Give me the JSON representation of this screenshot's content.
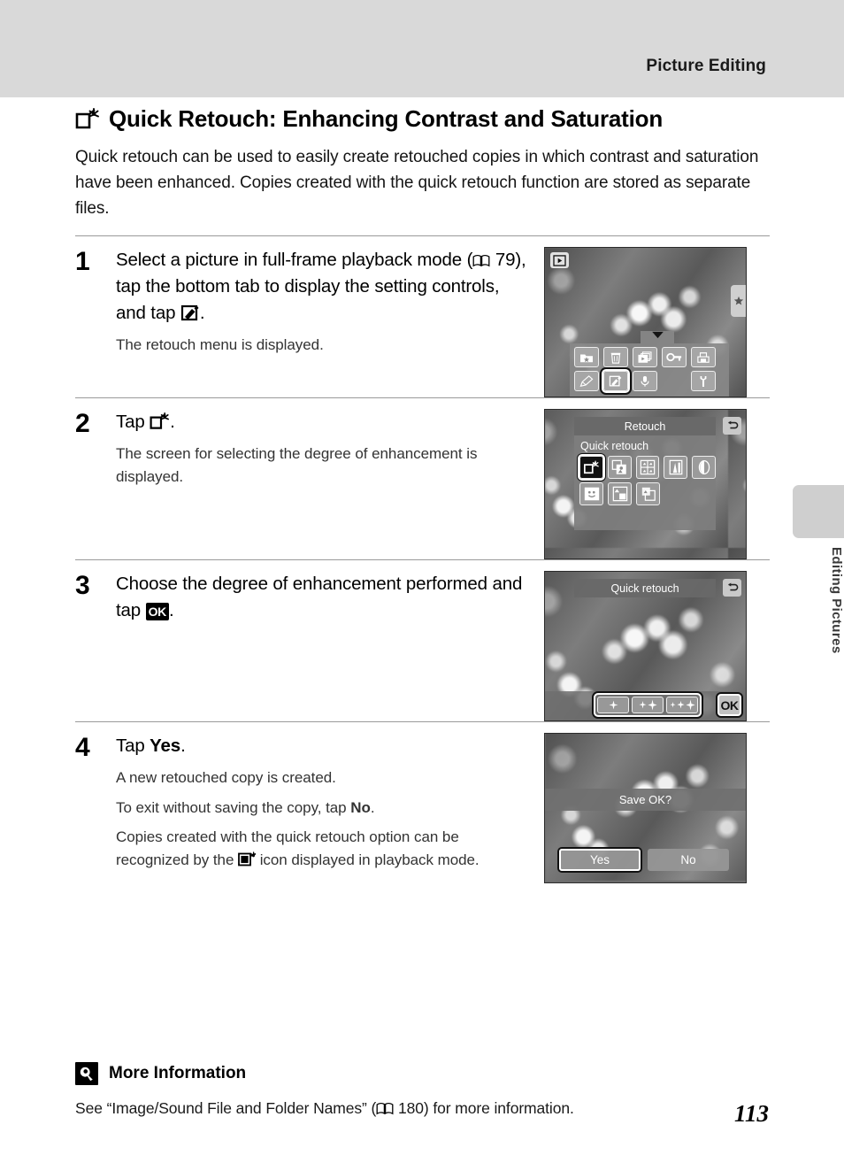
{
  "header": {
    "title": "Picture Editing"
  },
  "side_tab": {
    "label": "Editing Pictures"
  },
  "section": {
    "icon": "quick-retouch-icon",
    "heading": "Quick Retouch: Enhancing Contrast and Saturation",
    "intro": "Quick retouch can be used to easily create retouched copies in which contrast and saturation have been enhanced. Copies created with the quick retouch function are stored as separate files."
  },
  "steps": [
    {
      "number": "1",
      "title_before": "Select a picture in full-frame playback mode (",
      "ref_page": "79",
      "title_middle": "), tap the bottom tab to display the setting controls, and tap ",
      "title_icon": "retouch-pen-icon",
      "title_after": ".",
      "detail": "The retouch menu is displayed."
    },
    {
      "number": "2",
      "title_before": "Tap ",
      "title_icon": "quick-retouch-icon",
      "title_after": ".",
      "detail": "The screen for selecting the degree of enhancement is displayed."
    },
    {
      "number": "3",
      "title_before": "Choose the degree of enhancement performed and tap ",
      "title_icon": "ok-icon",
      "ok_label": "OK",
      "title_after": ".",
      "detail": ""
    },
    {
      "number": "4",
      "title_before": "Tap ",
      "title_bold": "Yes",
      "title_after": ".",
      "detail_1": "A new retouched copy is created.",
      "detail_2_before": "To exit without saving the copy, tap ",
      "detail_2_bold": "No",
      "detail_2_after": ".",
      "detail_3_before": "Copies created with the quick retouch option can be recognized by the ",
      "detail_3_icon": "retouched-copy-badge-icon",
      "detail_3_after": " icon displayed in playback mode."
    }
  ],
  "screens": {
    "shot1": {
      "playback_badge": "playback-icon",
      "favorites_tab": "star-icon",
      "toolbar_icons_row1": [
        "favorites-folder-icon",
        "delete-trash-icon",
        "slideshow-icon",
        "protect-key-icon",
        "print-order-icon"
      ],
      "toolbar_icons_row2": [
        "paint-pencil-icon",
        "retouch-pen-icon",
        "voice-memo-icon",
        "spacer",
        "setup-wrench-icon"
      ],
      "selected_icon": "retouch-pen-icon"
    },
    "shot2": {
      "menu_title": "Retouch",
      "menu_selected_label": "Quick retouch",
      "back_button": "back-arrow-icon",
      "menu_icons_row1": [
        "quick-retouch-icon",
        "d-lighting-icon",
        "soft-filter-icon",
        "color-options-icon",
        "perspective-icon"
      ],
      "menu_icons_row2": [
        "skin-softening-icon",
        "small-picture-icon",
        "crop-icon"
      ],
      "selected_icon": "quick-retouch-icon"
    },
    "shot3": {
      "title": "Quick retouch",
      "back_button": "back-arrow-icon",
      "levels": [
        "low-1-sparkle",
        "normal-2-sparkle",
        "high-3-sparkle"
      ],
      "ok_label": "OK"
    },
    "shot4": {
      "prompt": "Save OK?",
      "yes_label": "Yes",
      "no_label": "No",
      "selected_button": "Yes"
    }
  },
  "more_information": {
    "icon": "light-bulb-icon",
    "heading": "More Information",
    "text_before": "See “Image/Sound File and Folder Names” (",
    "ref_page": "180",
    "text_after": ") for more information."
  },
  "page_number": "113"
}
